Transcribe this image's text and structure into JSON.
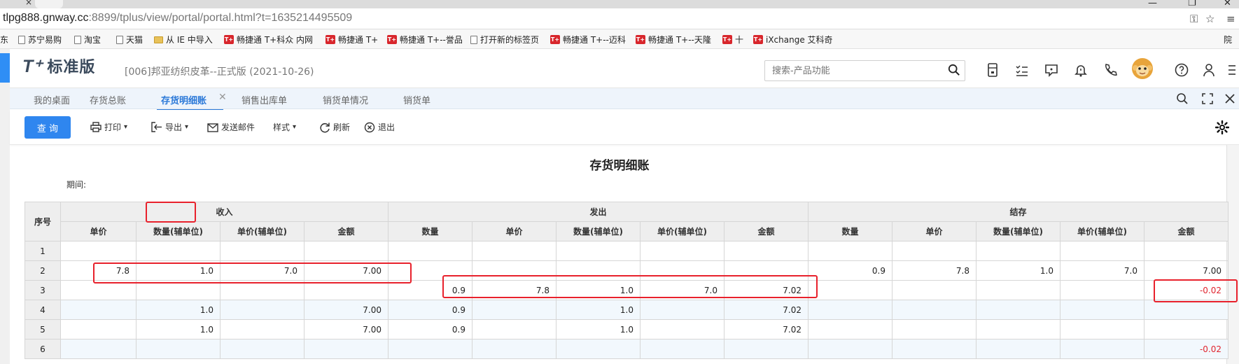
{
  "browser": {
    "tab_close": "×",
    "window_controls": [
      "—",
      "❐",
      "✕"
    ],
    "url_host": "tlpg888.gnway.cc",
    "url_rest": ":8899/tplus/view/portal/portal.html?t=1635214495509",
    "bookmarks": [
      {
        "label": "东",
        "icon": "none"
      },
      {
        "label": "苏宁易购",
        "icon": "page"
      },
      {
        "label": "淘宝",
        "icon": "page"
      },
      {
        "label": "天猫",
        "icon": "page"
      },
      {
        "label": "从 IE 中导入",
        "icon": "folder"
      },
      {
        "label": "畅捷通 T+科众  内网",
        "icon": "tplus"
      },
      {
        "label": "畅捷通 T+",
        "icon": "tplus"
      },
      {
        "label": "畅捷通 T+--誉品",
        "icon": "tplus"
      },
      {
        "label": "打开新的标签页",
        "icon": "page"
      },
      {
        "label": "畅捷通 T+--迈科",
        "icon": "tplus"
      },
      {
        "label": "畅捷通 T+--天隆",
        "icon": "tplus"
      },
      {
        "label": "十",
        "icon": "tplus"
      },
      {
        "label": "iXchange 艾科奇",
        "icon": "tplus"
      }
    ],
    "extra_label": "院",
    "menu_icon": "≡"
  },
  "app": {
    "logo_mark": "T⁺",
    "edition": "标准版",
    "company": "[006]邦亚纺织皮革--正式版    (2021-10-26)",
    "search_placeholder": "搜索-产品功能",
    "accent": "#2f86ef",
    "negative_color": "#e0242e"
  },
  "tabs": [
    {
      "label": "我的桌面",
      "active": false
    },
    {
      "label": "存货总账",
      "active": false
    },
    {
      "label": "存货明细账",
      "active": true
    },
    {
      "label": "销售出库单",
      "active": false
    },
    {
      "label": "销货单情况",
      "active": false
    },
    {
      "label": "销货单",
      "active": false
    }
  ],
  "tab_close": "✕",
  "toolbar": {
    "query": "查 询",
    "print": "打印",
    "export": "导出",
    "email": "发送邮件",
    "style": "样式",
    "refresh": "刷新",
    "exit": "退出"
  },
  "report": {
    "title": "存货明细账",
    "period": "期间:",
    "seq_header": "序号",
    "groups": [
      "收入",
      "发出",
      "结存"
    ],
    "columns": {
      "in": [
        "单价",
        "数量(辅单位)",
        "单价(辅单位)",
        "金额"
      ],
      "out": [
        "数量",
        "单价",
        "数量(辅单位)",
        "单价(辅单位)",
        "金额"
      ],
      "bal": [
        "数量",
        "单价",
        "数量(辅单位)",
        "单价(辅单位)",
        "金额"
      ]
    },
    "rows": [
      {
        "seq": "1",
        "cells": [
          "",
          "",
          "",
          "",
          "",
          "",
          "",
          "",
          "",
          "",
          "",
          "",
          "",
          ""
        ]
      },
      {
        "seq": "2",
        "cells": [
          "7.8",
          "1.0",
          "7.0",
          "7.00",
          "",
          "",
          "",
          "",
          "",
          "0.9",
          "7.8",
          "1.0",
          "7.0",
          "7.00"
        ]
      },
      {
        "seq": "3",
        "cells": [
          "",
          "",
          "",
          "",
          "0.9",
          "7.8",
          "1.0",
          "7.0",
          "7.02",
          "",
          "",
          "",
          "",
          "-0.02"
        ]
      },
      {
        "seq": "4",
        "cells": [
          "",
          "1.0",
          "",
          "7.00",
          "0.9",
          "",
          "1.0",
          "",
          "7.02",
          "",
          "",
          "",
          "",
          ""
        ]
      },
      {
        "seq": "5",
        "cells": [
          "",
          "1.0",
          "",
          "7.00",
          "0.9",
          "",
          "1.0",
          "",
          "7.02",
          "",
          "",
          "",
          "",
          ""
        ]
      },
      {
        "seq": "6",
        "cells": [
          "",
          "",
          "",
          "",
          "",
          "",
          "",
          "",
          "",
          "",
          "",
          "",
          "",
          "-0.02"
        ]
      }
    ]
  }
}
